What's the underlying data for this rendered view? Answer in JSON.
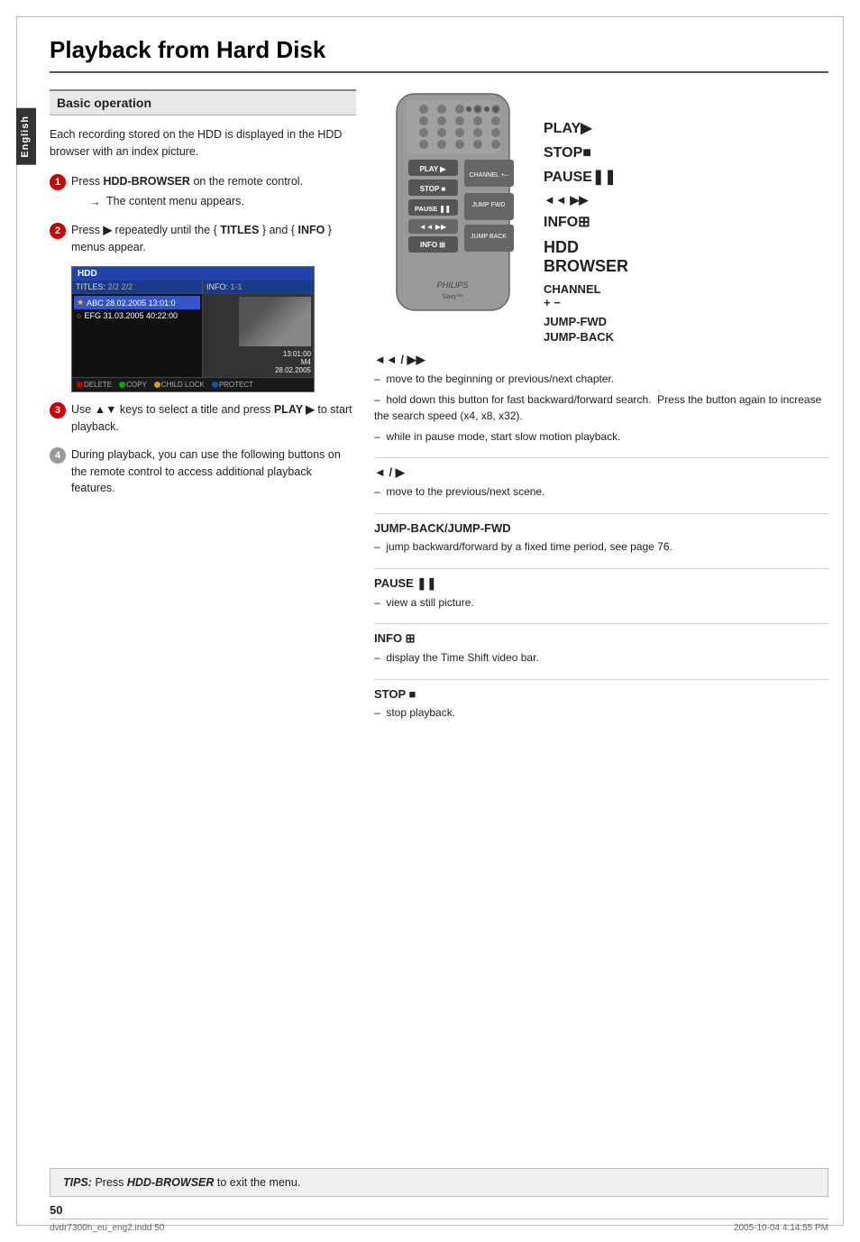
{
  "page": {
    "title": "Playback from Hard Disk",
    "page_number": "50",
    "side_tab": "English",
    "footer_left": "dvdr7300h_eu_eng2.indd  50",
    "footer_right": "2005-10-04   4:14:55 PM"
  },
  "section": {
    "header": "Basic operation",
    "intro": "Each recording stored on the HDD is displayed in the HDD browser with an index picture."
  },
  "steps": [
    {
      "num": "1",
      "text_before": "Press ",
      "bold": "HDD-BROWSER",
      "text_after": " on the remote control.",
      "sub": "The content menu appears."
    },
    {
      "num": "2",
      "text_before": "Press ",
      "bold": "▶",
      "text_after": " repeatedly until the { ",
      "bold2": "TITLES",
      "text_after2": " } and { ",
      "bold3": "INFO",
      "text_after3": " } menus appear."
    },
    {
      "num": "3",
      "text_before": "Use ▲▼ keys to select a title and press ",
      "bold": "PLAY ▶",
      "text_after": " to start playback."
    },
    {
      "num": "4",
      "text_before": "During playback, you can use the following buttons on the remote control to access additional playback features."
    }
  ],
  "hdd_browser": {
    "title": "HDD",
    "col1_header": "TITLES:",
    "col1_count": "2/2",
    "col2_header": "INFO:",
    "col2_count": "1-1",
    "item1": "ABC 28.02.2005  13:01:0",
    "item2": "EFG 31.03.2005  40:22:00",
    "thumb_info1": "13:01:00",
    "thumb_info2": "M4",
    "thumb_info3": "28.02.2005",
    "btn1": "DELETE",
    "btn2": "COPY",
    "btn3": "CHILD LOCK",
    "btn4": "PROTECT"
  },
  "remote_labels": {
    "play": "PLAY ▶",
    "stop": "STOP ■",
    "pause": "PAUSE ❚❚",
    "skipback": "◄◄  ▶▶",
    "info": "INFO ⊞",
    "hdd_browser": "HDD\nBROWSER",
    "channel": "CHANNEL\n+ –",
    "jump_fwd": "JUMP-FWD",
    "jump_back": "JUMP-BACK"
  },
  "details": [
    {
      "header": "◄◄ / ▶▶",
      "items": [
        "move to the beginning or previous/next chapter.",
        "hold down this button for fast backward/forward search.  Press the button again to increase the search speed (x4, x8, x32).",
        "while in pause mode, start slow motion playback."
      ]
    },
    {
      "header": "◄ / ▶",
      "items": [
        "move to the previous/next scene."
      ]
    },
    {
      "header": "JUMP-BACK/JUMP-FWD",
      "items": [
        "jump backward/forward by a fixed time period, see page 76."
      ]
    },
    {
      "header": "PAUSE ❚❚",
      "items": [
        "view a still picture."
      ]
    },
    {
      "header": "INFO ⊞",
      "items": [
        "display the Time Shift video bar."
      ]
    },
    {
      "header": "STOP ■",
      "items": [
        "stop playback."
      ]
    }
  ],
  "tips": {
    "label": "TIPS:",
    "text_before": "  Press ",
    "bold": "HDD-BROWSER",
    "text_after": " to exit the menu."
  }
}
